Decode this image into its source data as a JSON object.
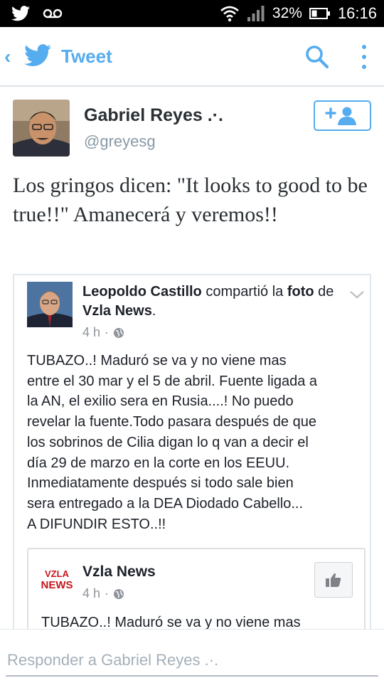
{
  "status_bar": {
    "battery": "32%",
    "time": "16:16"
  },
  "app_bar": {
    "title": "Tweet",
    "icons": [
      "back-chevron-icon",
      "twitter-bird-icon",
      "search-icon",
      "more-vert-icon"
    ]
  },
  "tweet": {
    "author_name": "Gabriel Reyes .·.",
    "author_handle": "@greyesg",
    "text": "Los gringos dicen: \"It looks to good to be true!!\" Amanecerá y veremos!!",
    "follow_icon": "follow-person-icon"
  },
  "photo": {
    "post": {
      "author": "Leopoldo Castillo",
      "verb": " compartió la",
      "object_prefix": "foto",
      "object_mid": " de ",
      "source": "Vzla News",
      "object_suffix": ".",
      "time": "4 h",
      "body_lines": [
        "TUBAZO..! Maduró se va y no viene mas",
        "entre el 30 mar y el 5 de abril. Fuente ligada a",
        "la AN, el exilio sera en Rusia....! No puedo",
        "revelar la fuente.Todo pasara después de que",
        "los sobrinos de Cilia digan lo q van a decir el",
        "día 29 de marzo en la corte en los EEUU.",
        "Inmediatamente después si todo sale bien",
        "sera entregado a la DEA Diodado Cabello...",
        "A DIFUNDIR ESTO..!!"
      ]
    },
    "shared": {
      "logo_text_top": "VZLA",
      "logo_text_bottom": "NEWS",
      "name": "Vzla News",
      "time": "4 h",
      "text": "TUBAZO..! Maduró se va y no viene mas"
    }
  },
  "reply": {
    "placeholder": "Responder a Gabriel Reyes .·."
  },
  "colors": {
    "twitter_blue": "#55acee",
    "facebook_text": "#1d2129",
    "muted": "#8899a6"
  }
}
